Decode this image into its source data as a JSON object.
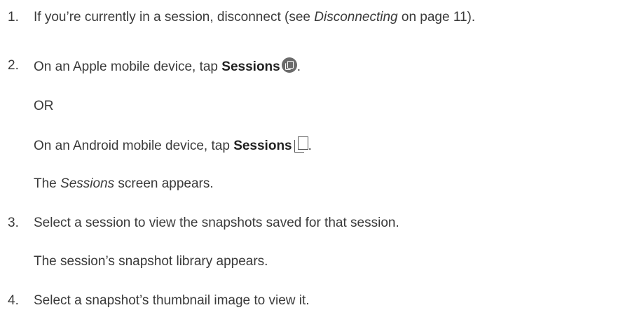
{
  "steps": {
    "s1": {
      "num": "1.",
      "pre": "If you’re currently in a session, disconnect (see ",
      "ref": "Disconnecting",
      "post": " on page 11)."
    },
    "s2": {
      "num": "2.",
      "pre": "On an Apple mobile device, tap ",
      "bold": "Sessions",
      "icon": "sessions-apple-icon",
      "post": "."
    },
    "or": "OR",
    "android": {
      "pre": "On an Android mobile device, tap ",
      "bold": "Sessions",
      "icon": "sessions-android-icon",
      "post": "."
    },
    "result2": {
      "italic": "Sessions",
      "post": " screen appears.",
      "pre": "The "
    },
    "s3": {
      "num": "3.",
      "text": "Select a session to view the snapshots saved for that session."
    },
    "result3": "The session’s snapshot library appears.",
    "s4": {
      "num": "4.",
      "text": "Select a snapshot’s thumbnail image to view it."
    }
  }
}
